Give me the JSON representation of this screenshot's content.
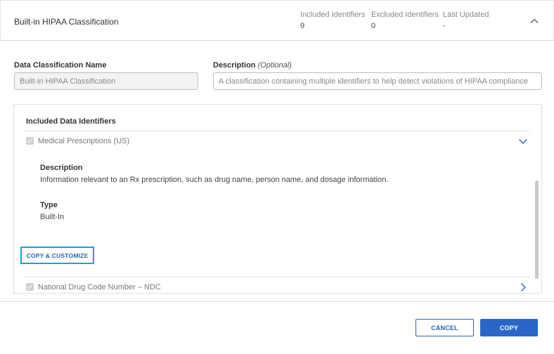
{
  "header": {
    "title": "Built-in HIPAA Classification",
    "stats": [
      {
        "label": "Included Identifiers",
        "value": "9"
      },
      {
        "label": "Excluded Identifiers",
        "value": "0"
      },
      {
        "label": "Last Updated",
        "value": "-"
      }
    ]
  },
  "form": {
    "name_label": "Data Classification Name",
    "name_value": "Built-in HIPAA Classification",
    "description_label": "Description",
    "description_optional": "(Optional)",
    "description_value": "A classification containing multiple identifiers to help detect violations of HIPAA compliance"
  },
  "identifiers": {
    "title": "Included Data Identifiers",
    "items": [
      {
        "label": "Medical Prescriptions (US)",
        "checked": true,
        "expanded": true,
        "description_heading": "Description",
        "description": "Information relevant to an Rx prescription, such as drug name, person name, and dosage information.",
        "type_heading": "Type",
        "type": "Built-In",
        "action": "COPY & CUSTOMIZE"
      },
      {
        "label": "National Drug Code Number – NDC",
        "checked": true,
        "expanded": false
      }
    ]
  },
  "footer": {
    "cancel_label": "CANCEL",
    "copy_label": "COPY"
  },
  "colors": {
    "accent": "#2a66c8",
    "focus_outline": "#1ea1d6"
  }
}
